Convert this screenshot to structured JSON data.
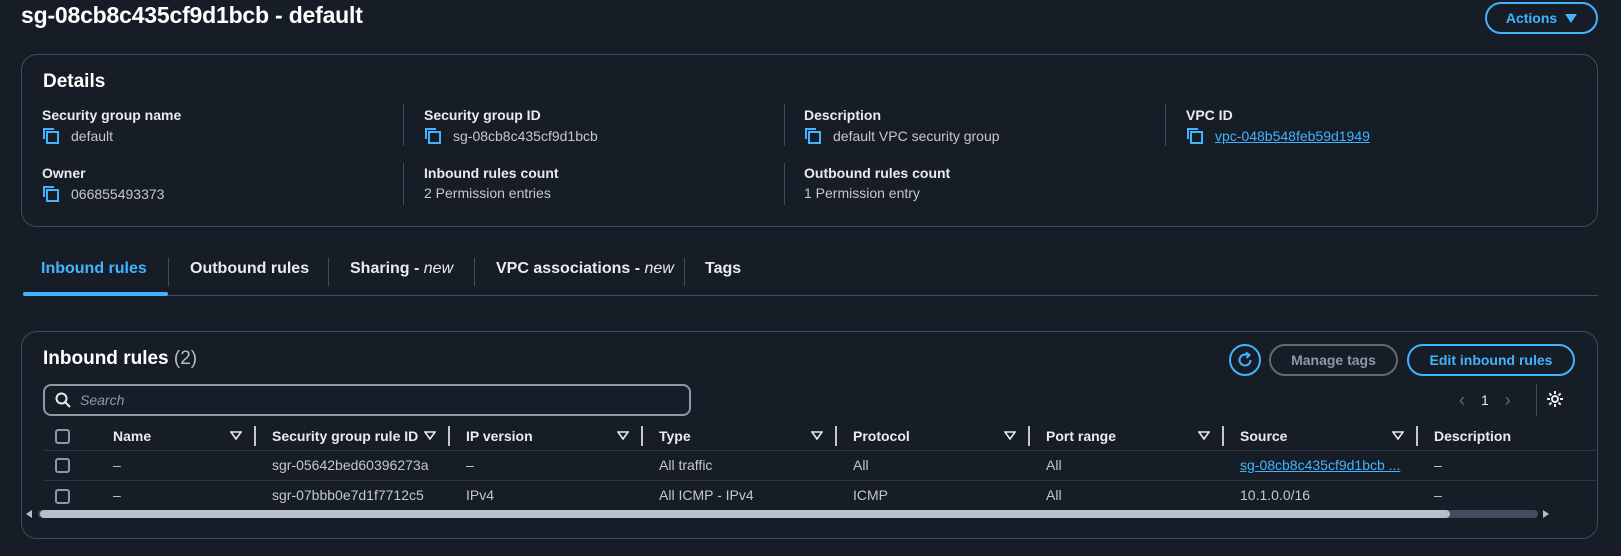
{
  "page": {
    "title": "sg-08cb8c435cf9d1bcb - default",
    "actions_label": "Actions"
  },
  "details": {
    "title": "Details",
    "fields": {
      "sg_name": {
        "label": "Security group name",
        "value": "default"
      },
      "sg_id": {
        "label": "Security group ID",
        "value": "sg-08cb8c435cf9d1bcb"
      },
      "description": {
        "label": "Description",
        "value": "default VPC security group"
      },
      "vpc_id": {
        "label": "VPC ID",
        "value": "vpc-048b548feb59d1949"
      },
      "owner": {
        "label": "Owner",
        "value": "066855493373"
      },
      "inbound_count": {
        "label": "Inbound rules count",
        "value": "2 Permission entries"
      },
      "outbound_count": {
        "label": "Outbound rules count",
        "value": "1 Permission entry"
      }
    }
  },
  "tabs": [
    {
      "label": "Inbound rules",
      "suffix": "",
      "active": true
    },
    {
      "label": "Outbound rules",
      "suffix": "",
      "active": false
    },
    {
      "label": "Sharing - ",
      "suffix": "new",
      "active": false
    },
    {
      "label": "VPC associations - ",
      "suffix": "new",
      "active": false
    },
    {
      "label": "Tags",
      "suffix": "",
      "active": false
    }
  ],
  "inbound": {
    "title": "Inbound rules",
    "count": "(2)",
    "manage_tags_label": "Manage tags",
    "edit_label": "Edit inbound rules",
    "search_placeholder": "Search",
    "page_number": "1",
    "columns": [
      "Name",
      "Security group rule ID",
      "IP version",
      "Type",
      "Protocol",
      "Port range",
      "Source",
      "Description"
    ],
    "rows": [
      {
        "name": "–",
        "rule_id": "sgr-05642bed60396273a",
        "ip_version": "–",
        "type": "All traffic",
        "protocol": "All",
        "port_range": "All",
        "source": "sg-08cb8c435cf9d1bcb ...",
        "description": "–"
      },
      {
        "name": "–",
        "rule_id": "sgr-07bbb0e7d1f7712c5",
        "ip_version": "IPv4",
        "type": "All ICMP - IPv4",
        "protocol": "ICMP",
        "port_range": "All",
        "source": "10.1.0.0/16",
        "description": "–"
      }
    ]
  },
  "icons": {
    "copy": "copy-icon",
    "refresh": "refresh-icon",
    "search": "search-icon",
    "settings": "gear-icon",
    "caret": "caret-down-icon"
  },
  "colors": {
    "background": "#161d26",
    "accent": "#42b4ff",
    "border": "#414d5c",
    "text": "#e9ebed"
  }
}
